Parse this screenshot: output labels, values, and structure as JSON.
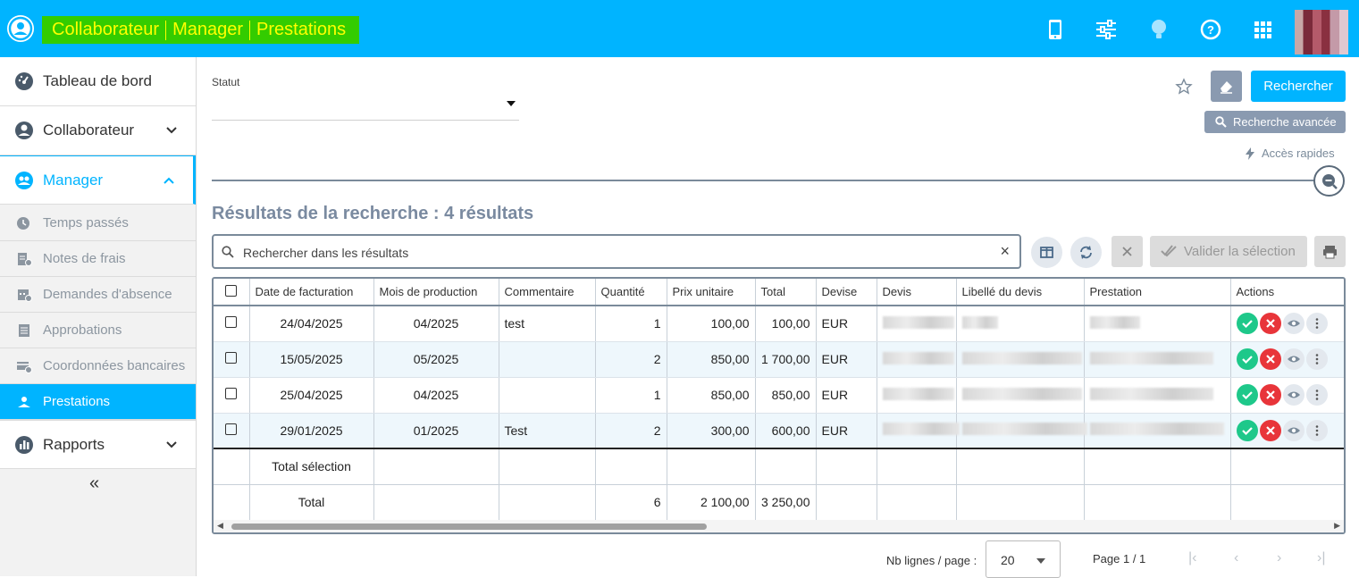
{
  "header": {
    "breadcrumbs": [
      "Collaborateur",
      "Manager",
      "Prestations"
    ],
    "icons": [
      "mobile-icon",
      "sliders-icon",
      "lightbulb-icon",
      "help-icon",
      "apps-grid-icon"
    ]
  },
  "sidebar": {
    "items": [
      {
        "label": "Tableau de bord",
        "icon": "dashboard-icon"
      },
      {
        "label": "Collaborateur",
        "icon": "user-circle-icon"
      },
      {
        "label": "Manager",
        "icon": "team-icon"
      },
      {
        "label": "Rapports",
        "icon": "chart-icon"
      }
    ],
    "subitems": [
      {
        "label": "Temps passés",
        "icon": "clock-icon"
      },
      {
        "label": "Notes de frais",
        "icon": "receipt-icon"
      },
      {
        "label": "Demandes d'absence",
        "icon": "calendar-icon"
      },
      {
        "label": "Approbations",
        "icon": "list-icon"
      },
      {
        "label": "Coordonnées bancaires",
        "icon": "bank-icon"
      },
      {
        "label": "Prestations",
        "icon": "handshake-icon"
      }
    ],
    "collapse": "«"
  },
  "filters": {
    "statut_label": "Statut",
    "statut_value": ""
  },
  "actions": {
    "search": "Rechercher",
    "advanced": "Recherche avancée",
    "quick_access": "Accès rapides",
    "validate": "Valider la sélection"
  },
  "results": {
    "title": "Résultats de la recherche : 4 résultats",
    "search_placeholder": "Rechercher dans les résultats"
  },
  "table": {
    "columns": [
      "Date de facturation",
      "Mois de production",
      "Commentaire",
      "Quantité",
      "Prix unitaire",
      "Total",
      "Devise",
      "Devis",
      "Libellé du devis",
      "Prestation",
      "Actions"
    ],
    "rows": [
      {
        "date": "24/04/2025",
        "mois": "04/2025",
        "commentaire": "test",
        "quantite": "1",
        "prix": "100,00",
        "total": "100,00",
        "devise": "EUR"
      },
      {
        "date": "15/05/2025",
        "mois": "05/2025",
        "commentaire": "",
        "quantite": "2",
        "prix": "850,00",
        "total": "1 700,00",
        "devise": "EUR"
      },
      {
        "date": "25/04/2025",
        "mois": "04/2025",
        "commentaire": "",
        "quantite": "1",
        "prix": "850,00",
        "total": "850,00",
        "devise": "EUR"
      },
      {
        "date": "29/01/2025",
        "mois": "01/2025",
        "commentaire": "Test",
        "quantite": "2",
        "prix": "300,00",
        "total": "600,00",
        "devise": "EUR"
      }
    ],
    "total_selection_label": "Total sélection",
    "total_label": "Total",
    "total_quantite": "6",
    "total_prix": "2 100,00",
    "total_total": "3 250,00"
  },
  "pagination": {
    "rows_label": "Nb lignes / page :",
    "rows_value": "20",
    "page_info": "Page 1 / 1"
  },
  "colors": {
    "header_bg": "#00b4ff",
    "breadcrumb_bg": "#33cc00",
    "breadcrumb_text": "#ffff00",
    "accept": "#1ec88a",
    "reject": "#e8353a"
  }
}
